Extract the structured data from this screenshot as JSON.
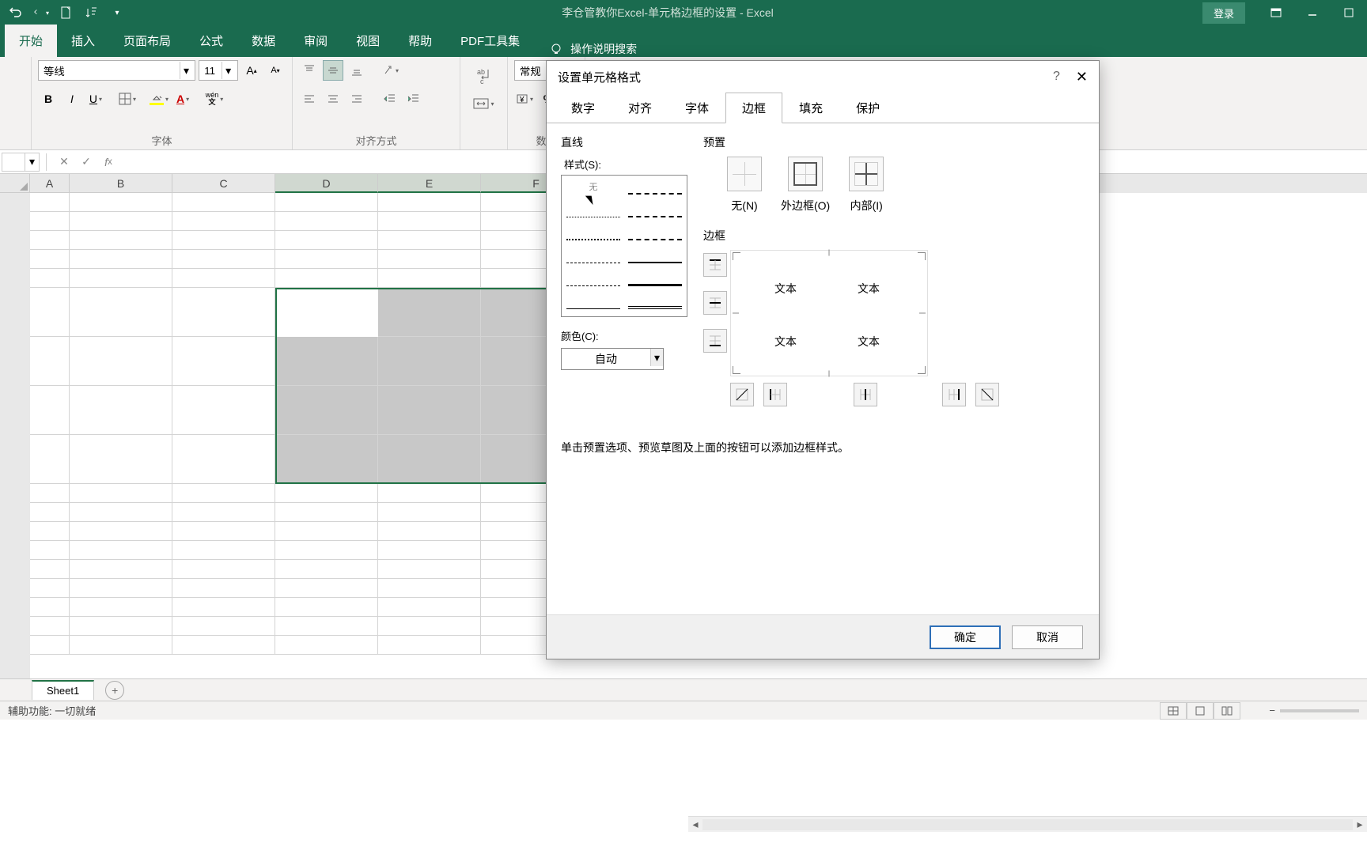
{
  "app": {
    "title": "李仓管教你Excel-单元格边框的设置 - Excel",
    "login": "登录"
  },
  "ribbon": {
    "tabs": [
      "开始",
      "插入",
      "页面布局",
      "公式",
      "数据",
      "审阅",
      "视图",
      "帮助",
      "PDF工具集"
    ],
    "tell_me": "操作说明搜索",
    "font_name": "等线",
    "font_size": "11",
    "wen": "wén",
    "number_format": "常规",
    "groups": {
      "font": "字体",
      "align": "对齐方式",
      "number": "数字"
    }
  },
  "grid": {
    "cols": [
      "A",
      "B",
      "C",
      "D",
      "E",
      "F"
    ]
  },
  "sheets": {
    "tab1": "Sheet1"
  },
  "status": {
    "ready": "辅助功能: 一切就绪"
  },
  "dialog": {
    "title": "设置单元格格式",
    "tabs": [
      "数字",
      "对齐",
      "字体",
      "边框",
      "填充",
      "保护"
    ],
    "line_section": "直线",
    "style_label": "样式(S):",
    "style_none": "无",
    "color_label": "颜色(C):",
    "color_auto": "自动",
    "preset_section": "预置",
    "preset_none": "无(N)",
    "preset_outline": "外边框(O)",
    "preset_inside": "内部(I)",
    "border_section": "边框",
    "preview_text": "文本",
    "hint": "单击预置选项、预览草图及上面的按钮可以添加边框样式。",
    "ok": "确定",
    "cancel": "取消"
  }
}
